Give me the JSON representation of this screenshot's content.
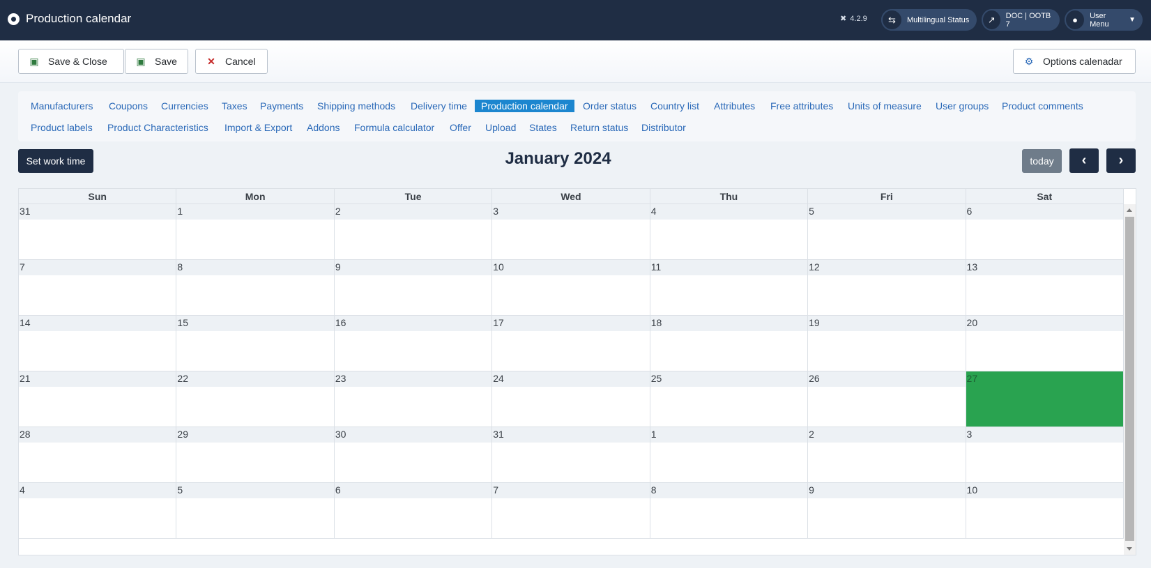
{
  "header": {
    "title": "Production calendar",
    "version": "4.2.9",
    "multilingual_status": "Multilingual Status",
    "doc_link": "DOC | OOTB 7",
    "user_menu": "User Menu"
  },
  "toolbar": {
    "save_close": "Save & Close",
    "save": "Save",
    "cancel": "Cancel",
    "options": "Options calenadar"
  },
  "submenu": {
    "items": [
      "Manufacturers",
      "Coupons",
      "Currencies",
      "Taxes",
      "Payments",
      "Shipping methods",
      "Delivery time",
      "Production calendar",
      "Order status",
      "Country list",
      "Attributes",
      "Free attributes",
      "Units of measure",
      "User groups",
      "Product comments",
      "Product labels",
      "Product Characteristics",
      "Import & Export",
      "Addons",
      "Formula calculator",
      "Offer",
      "Upload",
      "States",
      "Return status",
      "Distributor"
    ],
    "active": "Production calendar"
  },
  "calendar": {
    "set_work_time": "Set work time",
    "title": "January 2024",
    "today": "today",
    "weekdays": [
      "Sun",
      "Mon",
      "Tue",
      "Wed",
      "Thu",
      "Fri",
      "Sat"
    ],
    "weeks": [
      [
        "31",
        "1",
        "2",
        "3",
        "4",
        "5",
        "6"
      ],
      [
        "7",
        "8",
        "9",
        "10",
        "11",
        "12",
        "13"
      ],
      [
        "14",
        "15",
        "16",
        "17",
        "18",
        "19",
        "20"
      ],
      [
        "21",
        "22",
        "23",
        "24",
        "25",
        "26",
        "27"
      ],
      [
        "28",
        "29",
        "30",
        "31",
        "1",
        "2",
        "3"
      ],
      [
        "4",
        "5",
        "6",
        "7",
        "8",
        "9",
        "10"
      ]
    ],
    "highlighted_day": "27",
    "highlight_color": "#29a350"
  }
}
